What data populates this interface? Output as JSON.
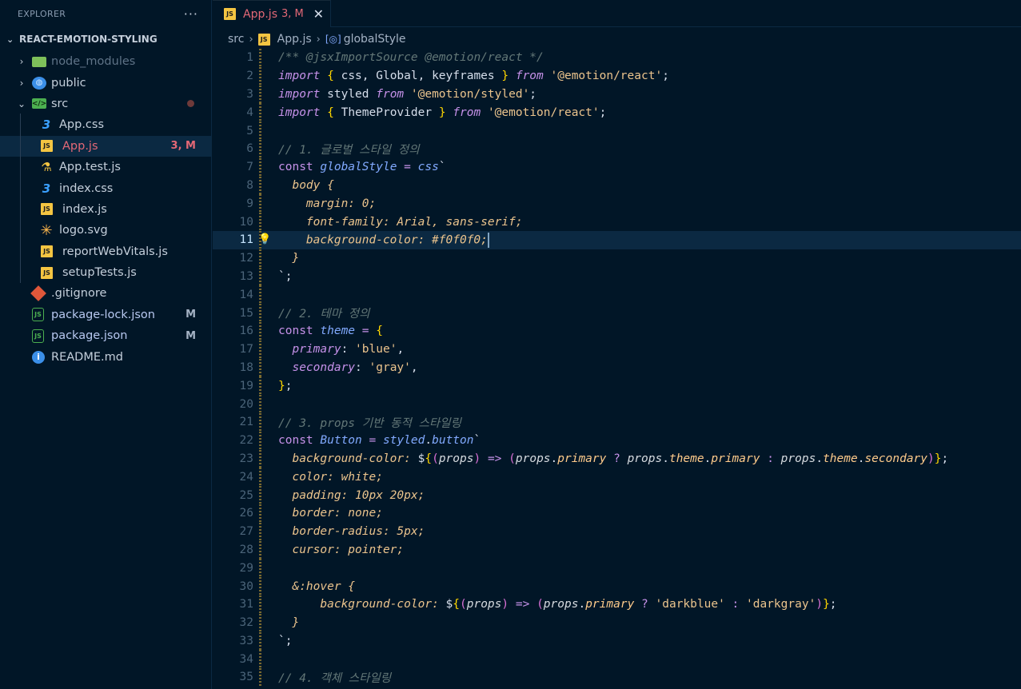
{
  "explorer": {
    "title": "EXPLORER",
    "more": "···",
    "project": "REACT-EMOTION-STYLING",
    "items": [
      {
        "label": "node_modules",
        "type": "folder-node",
        "chevron": "›",
        "dim": true
      },
      {
        "label": "public",
        "type": "folder-public",
        "chevron": "›"
      },
      {
        "label": "src",
        "type": "folder-src",
        "chevron": "⌄",
        "modified_dot": true
      },
      {
        "label": "App.css",
        "type": "css",
        "nested": true
      },
      {
        "label": "App.js",
        "type": "js",
        "nested": true,
        "badge": "3, M",
        "selected": true
      },
      {
        "label": "App.test.js",
        "type": "test",
        "nested": true
      },
      {
        "label": "index.css",
        "type": "css",
        "nested": true
      },
      {
        "label": "index.js",
        "type": "js",
        "nested": true
      },
      {
        "label": "logo.svg",
        "type": "svg",
        "nested": true
      },
      {
        "label": "reportWebVitals.js",
        "type": "js",
        "nested": true
      },
      {
        "label": "setupTests.js",
        "type": "js",
        "nested": true
      },
      {
        "label": ".gitignore",
        "type": "git"
      },
      {
        "label": "package-lock.json",
        "type": "json",
        "badge": "M"
      },
      {
        "label": "package.json",
        "type": "json",
        "badge": "M"
      },
      {
        "label": "README.md",
        "type": "info"
      }
    ]
  },
  "tab": {
    "icon": "JS",
    "label": "App.js",
    "status": "3, M",
    "close": "✕"
  },
  "breadcrumbs": {
    "folder": "src",
    "file": "App.js",
    "symbol": "globalStyle",
    "symbol_icon": "[◎]"
  },
  "editor": {
    "current_line": 11,
    "line_numbers": [
      "1",
      "2",
      "3",
      "4",
      "5",
      "6",
      "7",
      "8",
      "9",
      "10",
      "11",
      "12",
      "13",
      "14",
      "15",
      "16",
      "17",
      "18",
      "19",
      "20",
      "21",
      "22",
      "23",
      "24",
      "25",
      "26",
      "27",
      "28",
      "29",
      "30",
      "31",
      "32",
      "33",
      "34",
      "35"
    ],
    "lines": [
      [
        [
          "c-com",
          "/** "
        ],
        [
          "c-com",
          "@jsxImportSource"
        ],
        [
          "c-com",
          " @emotion/react */"
        ]
      ],
      [
        [
          "c-kw",
          "import"
        ],
        [
          "c-plain",
          " "
        ],
        [
          "c-brace",
          "{"
        ],
        [
          "c-plain",
          " css, Global, keyframes "
        ],
        [
          "c-brace",
          "}"
        ],
        [
          "c-plain",
          " "
        ],
        [
          "c-kw",
          "from"
        ],
        [
          "c-plain",
          " "
        ],
        [
          "c-str",
          "'@emotion/react'"
        ],
        [
          "c-plain",
          ";"
        ]
      ],
      [
        [
          "c-kw",
          "import"
        ],
        [
          "c-plain",
          " styled "
        ],
        [
          "c-kw",
          "from"
        ],
        [
          "c-plain",
          " "
        ],
        [
          "c-str",
          "'@emotion/styled'"
        ],
        [
          "c-plain",
          ";"
        ]
      ],
      [
        [
          "c-kw",
          "import"
        ],
        [
          "c-plain",
          " "
        ],
        [
          "c-brace",
          "{"
        ],
        [
          "c-plain",
          " ThemeProvider "
        ],
        [
          "c-brace",
          "}"
        ],
        [
          "c-plain",
          " "
        ],
        [
          "c-kw",
          "from"
        ],
        [
          "c-plain",
          " "
        ],
        [
          "c-str",
          "'@emotion/react'"
        ],
        [
          "c-plain",
          ";"
        ]
      ],
      [],
      [
        [
          "c-com",
          "// 1. 글로벌 스타일 정의"
        ]
      ],
      [
        [
          "c-kw2",
          "const"
        ],
        [
          "c-plain",
          " "
        ],
        [
          "c-fn",
          "globalStyle"
        ],
        [
          "c-plain",
          " "
        ],
        [
          "c-op",
          "="
        ],
        [
          "c-plain",
          " "
        ],
        [
          "c-fn",
          "css"
        ],
        [
          "c-plain",
          "`"
        ]
      ],
      [
        [
          "c-plain",
          "  "
        ],
        [
          "c-css",
          "body"
        ],
        [
          "c-plain",
          " "
        ],
        [
          "c-css",
          "{"
        ]
      ],
      [
        [
          "c-plain",
          "    "
        ],
        [
          "c-css",
          "margin: 0;"
        ]
      ],
      [
        [
          "c-plain",
          "    "
        ],
        [
          "c-css",
          "font-family: Arial, sans-serif;"
        ]
      ],
      [
        [
          "c-plain",
          "    "
        ],
        [
          "c-css",
          "background-color: #f0f0f0;"
        ]
      ],
      [
        [
          "c-plain",
          "  "
        ],
        [
          "c-css",
          "}"
        ]
      ],
      [
        [
          "c-plain",
          "`;"
        ]
      ],
      [],
      [
        [
          "c-com",
          "// 2. 테마 정의"
        ]
      ],
      [
        [
          "c-kw2",
          "const"
        ],
        [
          "c-plain",
          " "
        ],
        [
          "c-fn",
          "theme"
        ],
        [
          "c-plain",
          " "
        ],
        [
          "c-op",
          "="
        ],
        [
          "c-plain",
          " "
        ],
        [
          "c-brace",
          "{"
        ]
      ],
      [
        [
          "c-plain",
          "  "
        ],
        [
          "c-key",
          "primary"
        ],
        [
          "c-plain",
          ": "
        ],
        [
          "c-str",
          "'blue'"
        ],
        [
          "c-plain",
          ","
        ]
      ],
      [
        [
          "c-plain",
          "  "
        ],
        [
          "c-key",
          "secondary"
        ],
        [
          "c-plain",
          ": "
        ],
        [
          "c-str",
          "'gray'"
        ],
        [
          "c-plain",
          ","
        ]
      ],
      [
        [
          "c-brace",
          "}"
        ],
        [
          "c-plain",
          ";"
        ]
      ],
      [],
      [
        [
          "c-com",
          "// 3. props 기반 동적 스타일링"
        ]
      ],
      [
        [
          "c-kw2",
          "const"
        ],
        [
          "c-plain",
          " "
        ],
        [
          "c-fn",
          "Button"
        ],
        [
          "c-plain",
          " "
        ],
        [
          "c-op",
          "="
        ],
        [
          "c-plain",
          " "
        ],
        [
          "c-fn",
          "styled"
        ],
        [
          "c-plain",
          "."
        ],
        [
          "c-fn",
          "button"
        ],
        [
          "c-plain",
          "`"
        ]
      ],
      [
        [
          "c-plain",
          "  "
        ],
        [
          "c-css",
          "background-color: "
        ],
        [
          "c-plain",
          "$"
        ],
        [
          "c-brace",
          "{"
        ],
        [
          "c-brace2",
          "("
        ],
        [
          "c-var",
          "props"
        ],
        [
          "c-brace2",
          ")"
        ],
        [
          "c-plain",
          " "
        ],
        [
          "c-op",
          "=>"
        ],
        [
          "c-plain",
          " "
        ],
        [
          "c-brace2",
          "("
        ],
        [
          "c-var",
          "props"
        ],
        [
          "c-plain",
          "."
        ],
        [
          "c-y",
          "primary"
        ],
        [
          "c-plain",
          " "
        ],
        [
          "c-op",
          "?"
        ],
        [
          "c-plain",
          " "
        ],
        [
          "c-var",
          "props"
        ],
        [
          "c-plain",
          "."
        ],
        [
          "c-y",
          "theme"
        ],
        [
          "c-plain",
          "."
        ],
        [
          "c-y",
          "primary"
        ],
        [
          "c-plain",
          " "
        ],
        [
          "c-op",
          ":"
        ],
        [
          "c-plain",
          " "
        ],
        [
          "c-var",
          "props"
        ],
        [
          "c-plain",
          "."
        ],
        [
          "c-y",
          "theme"
        ],
        [
          "c-plain",
          "."
        ],
        [
          "c-y",
          "secondary"
        ],
        [
          "c-brace2",
          ")"
        ],
        [
          "c-brace",
          "}"
        ],
        [
          "c-plain",
          ";"
        ]
      ],
      [
        [
          "c-plain",
          "  "
        ],
        [
          "c-css",
          "color: white;"
        ]
      ],
      [
        [
          "c-plain",
          "  "
        ],
        [
          "c-css",
          "padding: 10px 20px;"
        ]
      ],
      [
        [
          "c-plain",
          "  "
        ],
        [
          "c-css",
          "border: none;"
        ]
      ],
      [
        [
          "c-plain",
          "  "
        ],
        [
          "c-css",
          "border-radius: 5px;"
        ]
      ],
      [
        [
          "c-plain",
          "  "
        ],
        [
          "c-css",
          "cursor: pointer;"
        ]
      ],
      [],
      [
        [
          "c-plain",
          "  "
        ],
        [
          "c-css",
          "&:hover {"
        ]
      ],
      [
        [
          "c-plain",
          "      "
        ],
        [
          "c-css",
          "background-color: "
        ],
        [
          "c-plain",
          "$"
        ],
        [
          "c-brace",
          "{"
        ],
        [
          "c-brace2",
          "("
        ],
        [
          "c-var",
          "props"
        ],
        [
          "c-brace2",
          ")"
        ],
        [
          "c-plain",
          " "
        ],
        [
          "c-op",
          "=>"
        ],
        [
          "c-plain",
          " "
        ],
        [
          "c-brace2",
          "("
        ],
        [
          "c-var",
          "props"
        ],
        [
          "c-plain",
          "."
        ],
        [
          "c-y",
          "primary"
        ],
        [
          "c-plain",
          " "
        ],
        [
          "c-op",
          "?"
        ],
        [
          "c-plain",
          " "
        ],
        [
          "c-str",
          "'darkblue'"
        ],
        [
          "c-plain",
          " "
        ],
        [
          "c-op",
          ":"
        ],
        [
          "c-plain",
          " "
        ],
        [
          "c-str",
          "'darkgray'"
        ],
        [
          "c-brace2",
          ")"
        ],
        [
          "c-brace",
          "}"
        ],
        [
          "c-plain",
          ";"
        ]
      ],
      [
        [
          "c-plain",
          "  "
        ],
        [
          "c-css",
          "}"
        ]
      ],
      [
        [
          "c-plain",
          "`;"
        ]
      ],
      [],
      [
        [
          "c-com",
          "// 4. 객체 스타일링"
        ]
      ]
    ]
  },
  "icons": {
    "lightbulb": "lightbulb-icon",
    "close": "close-icon",
    "chevron": "chevron-right-icon"
  },
  "colors": {
    "background": "#011627",
    "selection": "#0b2942",
    "tab_modified": "#e46876"
  }
}
